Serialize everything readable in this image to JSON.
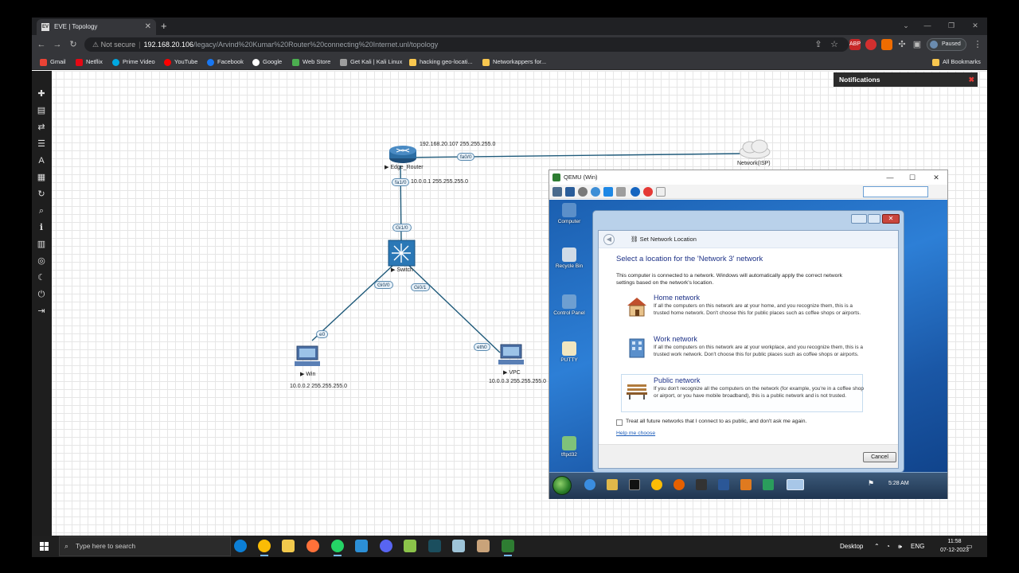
{
  "browser": {
    "tab_title": "EVE | Topology",
    "tab_favicon": "EV",
    "new_tab": "+",
    "url_warning": "Not secure",
    "url_host": "192.168.20.106",
    "url_path": "/legacy/Arvind%20Kumar%20Router%20connecting%20Internet.unl/topology",
    "profile_status": "Paused",
    "bookmarks": [
      "Gmail",
      "Netflix",
      "Prime Video",
      "YouTube",
      "Facebook",
      "Google",
      "Web Store",
      "Get Kali | Kali Linux",
      "hacking geo-locati...",
      "Networkappers for..."
    ],
    "all_bookmarks": "All Bookmarks"
  },
  "notifications": {
    "title": "Notifications"
  },
  "topology": {
    "nodes": {
      "router": "Edge_Router",
      "cloud": "Network(ISP)",
      "switch": "Switch",
      "win": "Win",
      "vpc": "VPC"
    },
    "ips": {
      "router_wan": "192.168.20.107 255.255.255.0",
      "router_lan": "10.0.0.1 255.255.255.0",
      "win": "10.0.0.2 255.255.255.0",
      "vpc": "10.0.0.3 255.255.255.0"
    },
    "ports": {
      "router_fa00": "fa0/0",
      "router_fa10": "fa1/0",
      "switch_gi10": "Gi1/0",
      "switch_gi00": "Gi0/0",
      "switch_gi01": "Gi0/1",
      "win_e0": "e0",
      "vpc_eth0": "eth0"
    }
  },
  "qemu": {
    "title": "QEMU (Win)",
    "desktop_icons": [
      "Computer",
      "Recycle Bin",
      "Control Panel",
      "PUTTY",
      "tftpd32"
    ],
    "clock": "5:28 AM",
    "dialog": {
      "title": "Set Network Location",
      "heading": "Select a location for the 'Network  3' network",
      "description": "This computer is connected to a network. Windows will automatically apply the correct network settings based on the network's location.",
      "options": [
        {
          "title": "Home network",
          "desc": "If all the computers on this network are at your home, and you recognize them, this is a trusted home network.  Don't choose this for public places such as coffee shops or airports."
        },
        {
          "title": "Work network",
          "desc": "If all the computers on this network are at your workplace, and you recognize them, this is a trusted work network.  Don't choose this for public places such as coffee shops or airports."
        },
        {
          "title": "Public network",
          "desc": "If you don't recognize all the computers on the network (for example, you're in a coffee shop or airport, or you have mobile broadband), this is a public network and is not trusted."
        }
      ],
      "checkbox_label": "Treat all future networks that I connect to as public, and don't ask me again.",
      "help_link": "Help me choose",
      "cancel": "Cancel"
    }
  },
  "taskbar": {
    "search_placeholder": "Type here to search",
    "desktop": "Desktop",
    "lang": "ENG",
    "time": "11:58",
    "date": "07-12-2023"
  }
}
